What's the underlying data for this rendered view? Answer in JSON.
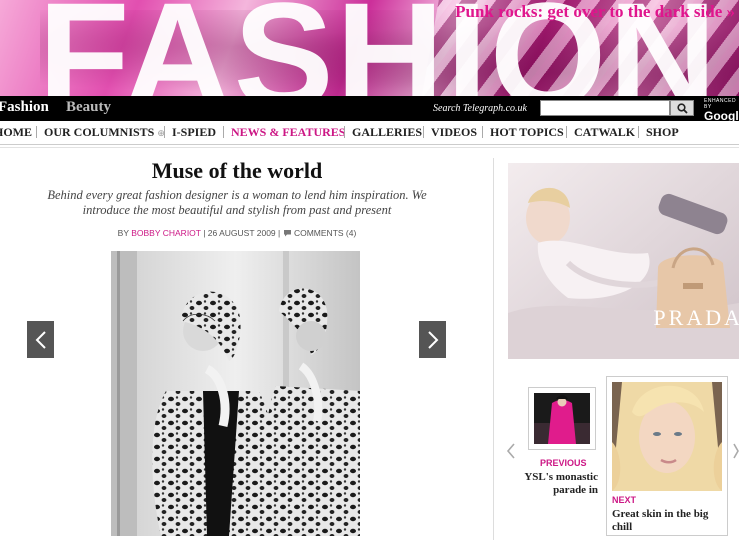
{
  "banner": {
    "word": "FASHION",
    "promo": "Punk rocks: get over to the dark side »"
  },
  "topbar": {
    "tabs": [
      "Fashion",
      "Beauty"
    ],
    "search_label": "Search Telegraph.co.uk",
    "search_placeholder": "",
    "search_icon": "magnifier-icon",
    "google_enhanced": "ENHANCED BY",
    "google_brand": "Google"
  },
  "nav": {
    "items": [
      "HOME",
      "OUR COLUMNISTS",
      "I-SPIED",
      "NEWS & FEATURES",
      "GALLERIES",
      "VIDEOS",
      "HOT TOPICS",
      "CATWALK",
      "SHOP"
    ],
    "columnists_plus": "⊕",
    "active_index": 3,
    "active_color": "#cc1785"
  },
  "article": {
    "title": "Muse of the world",
    "standfirst": "Behind every great fashion designer is a woman to lend him inspiration. We introduce the most beautiful and stylish from past and present",
    "byline_prefix": "BY",
    "author": "BOBBY CHARIOT",
    "date": "26 AUGUST 2009",
    "comments": "COMMENTS (4)"
  },
  "ad": {
    "brand": "PRADA"
  },
  "carousel": {
    "previous_label": "PREVIOUS",
    "previous_caption": "YSL's monastic parade in",
    "next_label": "NEXT",
    "next_caption": "Great skin in the big chill"
  }
}
